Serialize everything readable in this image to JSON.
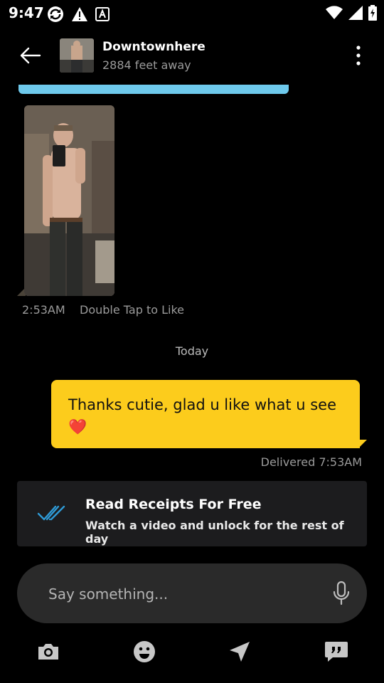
{
  "status_bar": {
    "time": "9:47",
    "left_icons": [
      "sync-icon",
      "warning-icon",
      "a-box-icon"
    ],
    "right_icons": [
      "wifi-icon",
      "signal-icon",
      "battery-icon"
    ]
  },
  "header": {
    "back_icon": "arrow-left-icon",
    "name": "Downtownhere",
    "distance": "2884 feet away",
    "more_icon": "more-vertical-icon"
  },
  "messages": {
    "received_photo": {
      "time": "2:53AM",
      "hint": "Double Tap to Like"
    },
    "day_separator": "Today",
    "sent": {
      "text": "Thanks cutie, glad u like what u see ❤️",
      "status": "Delivered 7:53AM"
    }
  },
  "read_receipts": {
    "title": "Read Receipts For Free",
    "subtitle": "Watch a video and unlock for the rest of day",
    "icon": "double-check-icon"
  },
  "composer": {
    "placeholder": "Say something...",
    "mic_icon": "microphone-icon"
  },
  "toolbar": [
    "camera-icon",
    "emoji-icon",
    "send-location-icon",
    "saved-phrases-icon"
  ],
  "colors": {
    "accent_yellow": "#fccc1c",
    "accent_blue": "#6ec9ec",
    "check_blue": "#2f9bd7",
    "background": "#000000",
    "banner": "#1c1c1e",
    "input": "#2a2a2a"
  }
}
